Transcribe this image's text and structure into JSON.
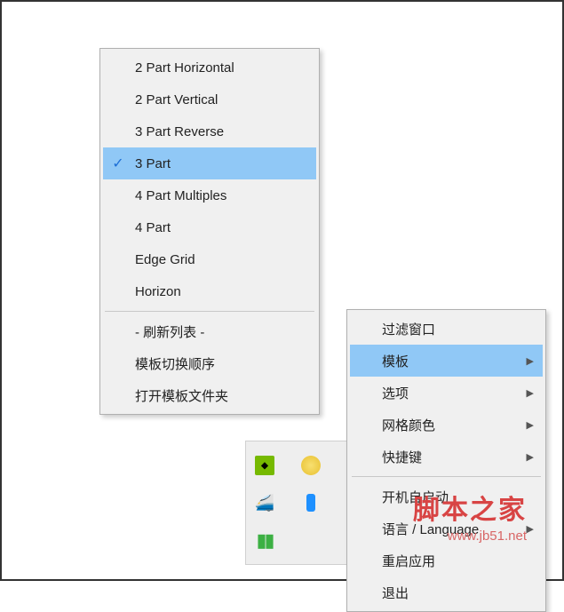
{
  "submenu": {
    "items": [
      {
        "label": "2 Part Horizontal",
        "checked": false
      },
      {
        "label": "2 Part Vertical",
        "checked": false
      },
      {
        "label": "3 Part Reverse",
        "checked": false
      },
      {
        "label": "3 Part",
        "checked": true
      },
      {
        "label": "4 Part Multiples",
        "checked": false
      },
      {
        "label": "4 Part",
        "checked": false
      },
      {
        "label": "Edge Grid",
        "checked": false
      },
      {
        "label": "Horizon",
        "checked": false
      }
    ],
    "refresh": "- 刷新列表 -",
    "switch_order": "模板切换顺序",
    "open_folder": "打开模板文件夹"
  },
  "mainmenu": {
    "filter_window": "过滤窗口",
    "template": "模板",
    "options": "选项",
    "grid_color": "网格颜色",
    "shortcut": "快捷键",
    "autostart": "开机自启动",
    "language": "语言 / Language",
    "restart": "重启应用",
    "exit": "退出"
  },
  "watermark": {
    "title": "脚本之家",
    "url": "www.jb51.net"
  }
}
